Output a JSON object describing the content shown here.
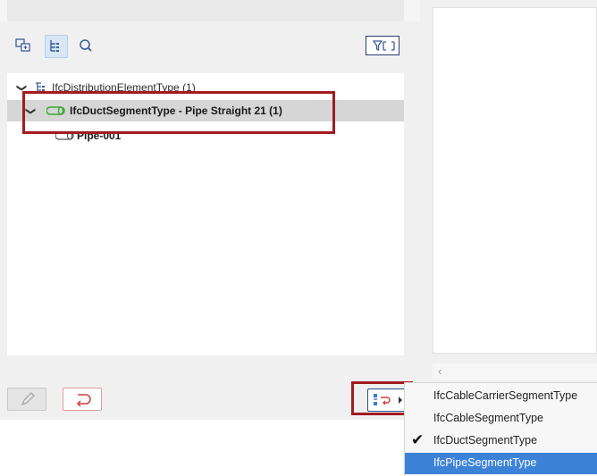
{
  "tree": {
    "parent": {
      "label": "IfcDistributionElementType (1)"
    },
    "selected": {
      "label": "IfcDuctSegmentType - Pipe Straight 21 (1)"
    },
    "child": {
      "label": "Pipe-001"
    }
  },
  "type_menu": {
    "items": [
      {
        "label": "IfcCableCarrierSegmentType",
        "checked": false,
        "highlighted": false
      },
      {
        "label": "IfcCableSegmentType",
        "checked": false,
        "highlighted": false
      },
      {
        "label": "IfcDuctSegmentType",
        "checked": true,
        "highlighted": false
      },
      {
        "label": "IfcPipeSegmentType",
        "checked": false,
        "highlighted": true
      }
    ]
  },
  "icons": {
    "toolbar": [
      "add-element-icon",
      "tree-view-icon",
      "search-icon",
      "filter-icon"
    ],
    "bottom": [
      "pencil-icon",
      "reverse-direction-icon",
      "assign-type-icon"
    ],
    "tree": [
      "tree-group-icon",
      "segment-type-icon",
      "segment-icon"
    ]
  },
  "colors": {
    "highlight_box": "#a21b20",
    "selection": "#d6d6d6",
    "menu_highlight": "#3c83d8",
    "segment_icon": "#3aa82f"
  }
}
